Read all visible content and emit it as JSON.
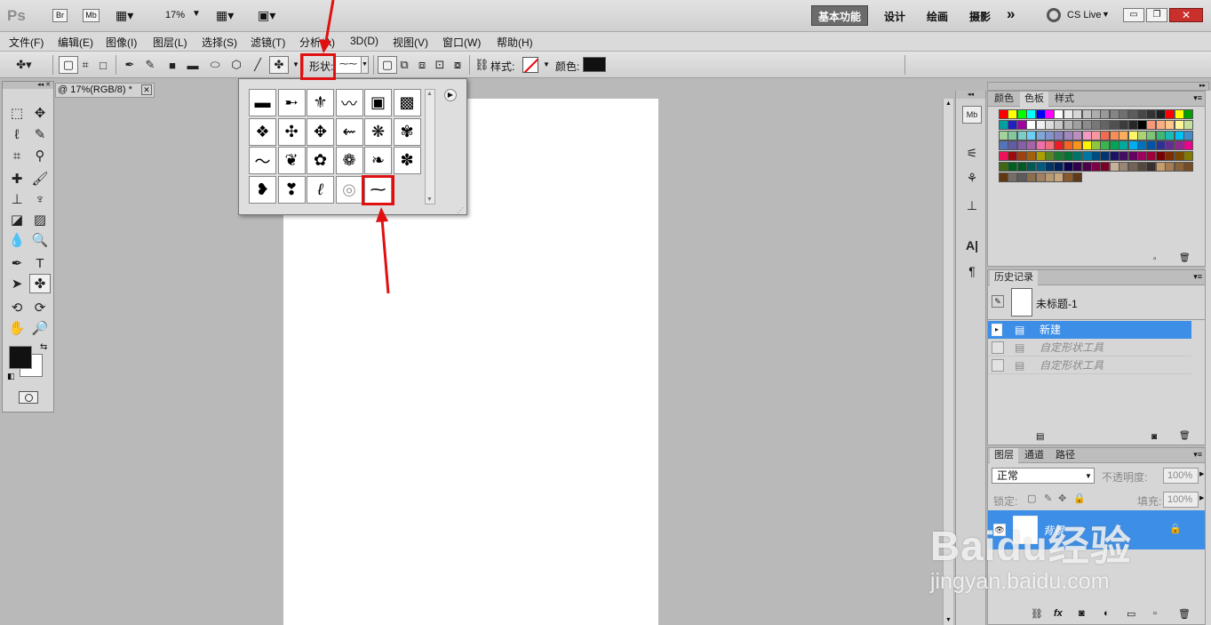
{
  "appbar": {
    "logo": "Ps",
    "bridge": "Br",
    "minibridge": "Mb",
    "zoom": "17%",
    "workspaces": [
      "基本功能",
      "设计",
      "绘画",
      "摄影"
    ],
    "active_workspace": "基本功能",
    "more": "»",
    "cs_live": "CS Live"
  },
  "menu": [
    "文件(F)",
    "编辑(E)",
    "图像(I)",
    "图层(L)",
    "选择(S)",
    "滤镜(T)",
    "分析(A)",
    "3D(D)",
    "视图(V)",
    "窗口(W)",
    "帮助(H)"
  ],
  "options": {
    "shape_label": "形状:",
    "style_label": "样式:",
    "color_label": "颜色:",
    "color_value": "#111111"
  },
  "document": {
    "tab_title": "@ 17%(RGB/8) *"
  },
  "shape_picker": {
    "shapes": [
      "banner-1-icon",
      "banner-2-icon",
      "fleur-de-lis-icon",
      "ornament-icon",
      "square-ornament-1-icon",
      "square-ornament-2-icon",
      "diamond-ornament-icon",
      "leaf-ornament-icon",
      "floral-tile-icon",
      "branch-icon",
      "flower-tile-1-icon",
      "flower-tile-2-icon",
      "swirl-icon",
      "leaf-cluster-icon",
      "vine-icon",
      "flower-1-icon",
      "flourish-icon",
      "flower-2-icon",
      "heart-leaf-icon",
      "heart-flourish-icon",
      "curl-icon",
      "spiral-icon",
      "wavy-line-icon"
    ],
    "glyphs": [
      "▬",
      "➸",
      "⚜",
      "〰",
      "▣",
      "▩",
      "❖",
      "✣",
      "✥",
      "⇜",
      "❋",
      "✾",
      "〜",
      "❦",
      "✿",
      "❁",
      "❧",
      "✽",
      "❥",
      "❣",
      "ℓ",
      "◎",
      "⁓"
    ]
  },
  "swatch_panel": {
    "tabs": [
      "颜色",
      "色板",
      "样式"
    ],
    "active": "色板",
    "rows": [
      [
        "#ff0000",
        "#ffff00",
        "#00ff00",
        "#00ffff",
        "#0000ff",
        "#ff00ff",
        "#ffffff",
        "#ebebeb",
        "#d6d6d6",
        "#c2c2c2",
        "#adadad",
        "#999999",
        "#858585",
        "#707070",
        "#5c5c5c",
        "#474747",
        "#333333",
        "#1f1f1f",
        "#ff0000",
        "#ffff00",
        "#00a000"
      ],
      [
        "#00a0a0",
        "#2020c0",
        "#a000a0",
        "#ffffff",
        "#f0f0f0",
        "#dcdcdc",
        "#c8c8c8",
        "#b4b4b4",
        "#a0a0a0",
        "#8c8c8c",
        "#787878",
        "#646464",
        "#505050",
        "#3c3c3c",
        "#282828",
        "#000000",
        "#f7977a",
        "#f9ad81",
        "#fdc68a",
        "#fff79a",
        "#c4df9b"
      ],
      [
        "#a3d39c",
        "#82ca9d",
        "#7bcdc8",
        "#6ecff6",
        "#7ea7d8",
        "#8493ca",
        "#8882be",
        "#a187be",
        "#bc8dbf",
        "#f49ac2",
        "#f6989d",
        "#f26c4f",
        "#f68e55",
        "#fbaf5d",
        "#fff568",
        "#acd372",
        "#7cc576",
        "#3bb878",
        "#1abbb4",
        "#00bff3",
        "#438cca"
      ],
      [
        "#5574b9",
        "#605ca8",
        "#855fa8",
        "#a763a8",
        "#f06ea9",
        "#f26d7d",
        "#ed1c24",
        "#f26522",
        "#f7941d",
        "#fff200",
        "#8dc73f",
        "#39b54a",
        "#00a651",
        "#00a99d",
        "#00aeef",
        "#0072bc",
        "#0054a6",
        "#2e3192",
        "#662d91",
        "#92278f",
        "#ec008c"
      ],
      [
        "#ed145b",
        "#9e0b0f",
        "#a0410d",
        "#a36209",
        "#aba000",
        "#598527",
        "#1a7b30",
        "#007236",
        "#00746b",
        "#0076a3",
        "#004b80",
        "#003471",
        "#1b1464",
        "#440e62",
        "#630460",
        "#9e005d",
        "#9e0039",
        "#790000",
        "#7b2e00",
        "#7d4900",
        "#827b00"
      ],
      [
        "#406618",
        "#005e20",
        "#005826",
        "#005952",
        "#005b7f",
        "#003663",
        "#002157",
        "#0d004c",
        "#32004b",
        "#4b0049",
        "#7b0046",
        "#7a0026",
        "#c7b299",
        "#998675",
        "#736357",
        "#534741",
        "#37302d",
        "#c69c6d",
        "#a67c52",
        "#8c6239",
        "#754c24"
      ],
      [
        "#603913",
        "#766e65",
        "#5c5c5c",
        "#8b6e4e",
        "#a08060",
        "#b89a72",
        "#c8a87c",
        "#8b5a2b",
        "#5e3a1a"
      ]
    ]
  },
  "history_panel": {
    "title": "历史记录",
    "snapshot": "未标题-1",
    "items": [
      "新建",
      "自定形状工具",
      "自定形状工具"
    ]
  },
  "layers_panel": {
    "tabs": [
      "图层",
      "通道",
      "路径"
    ],
    "active": "图层",
    "blend_mode": "正常",
    "opacity_label": "不透明度:",
    "opacity_value": "100%",
    "lock_label": "锁定:",
    "fill_label": "填充:",
    "fill_value": "100%",
    "layer_name": "背景"
  },
  "watermark": {
    "brand": "Baidu经验",
    "url": "jingyan.baidu.com"
  }
}
